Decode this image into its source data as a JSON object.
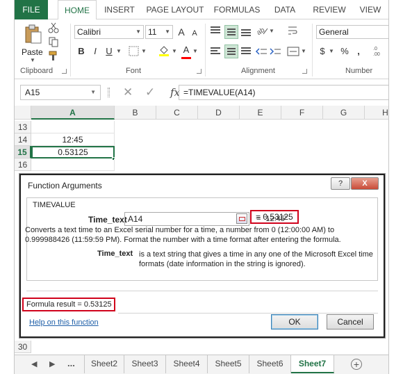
{
  "ribbon_tabs": [
    "FILE",
    "HOME",
    "INSERT",
    "PAGE LAYOUT",
    "FORMULAS",
    "DATA",
    "REVIEW",
    "VIEW"
  ],
  "clipboard": {
    "paste_label": "Paste",
    "group_label": "Clipboard"
  },
  "font": {
    "name": "Calibri",
    "size": "11",
    "group_label": "Font",
    "bold": "B",
    "italic": "I",
    "underline": "U",
    "grow": "A",
    "shrink": "A",
    "font_color": "A",
    "fill_color_hex": "#ffff00",
    "font_color_hex": "#ff0000"
  },
  "alignment": {
    "group_label": "Alignment"
  },
  "number": {
    "format": "General",
    "currency": "$",
    "percent": "%",
    "comma": ",",
    "group_label": "Number"
  },
  "formula_bar": {
    "name_box": "A15",
    "formula": "=TIMEVALUE(A14)",
    "fx": "fx"
  },
  "columns": [
    "A",
    "B",
    "C",
    "D",
    "E",
    "F",
    "G",
    "H"
  ],
  "rows": [
    {
      "num": "13",
      "a": ""
    },
    {
      "num": "14",
      "a": "12:45"
    },
    {
      "num": "15",
      "a": "0.53125"
    },
    {
      "num": "16",
      "a": ""
    }
  ],
  "dialog": {
    "title": "Function Arguments",
    "help_button": "?",
    "close_button": "X",
    "function_name": "TIMEVALUE",
    "arg_label": "Time_text",
    "arg_value": "A14",
    "arg_eval": "=  \"12:45\"",
    "fn_result": "=  0.53125",
    "description": "Converts a text time to an Excel serial number for a time, a number from 0 (12:00:00 AM) to 0.999988426 (11:59:59 PM). Format the number with a time format after entering the formula.",
    "arg_desc_label": "Time_text",
    "arg_desc": "is a text string that gives a time in any one of the Microsoft Excel time formats (date information in the string is ignored).",
    "formula_result": "Formula result =   0.53125",
    "help_link": "Help on this function",
    "ok": "OK",
    "cancel": "Cancel"
  },
  "bottom_row": "30",
  "sheet_nav": {
    "prev": "◀",
    "next": "▶",
    "more": "..."
  },
  "sheets": [
    "Sheet2",
    "Sheet3",
    "Sheet4",
    "Sheet5",
    "Sheet6",
    "Sheet7"
  ],
  "active_sheet": "Sheet7",
  "add_sheet": "+",
  "accent_color": "#217346",
  "highlight_color": "#d0021b"
}
